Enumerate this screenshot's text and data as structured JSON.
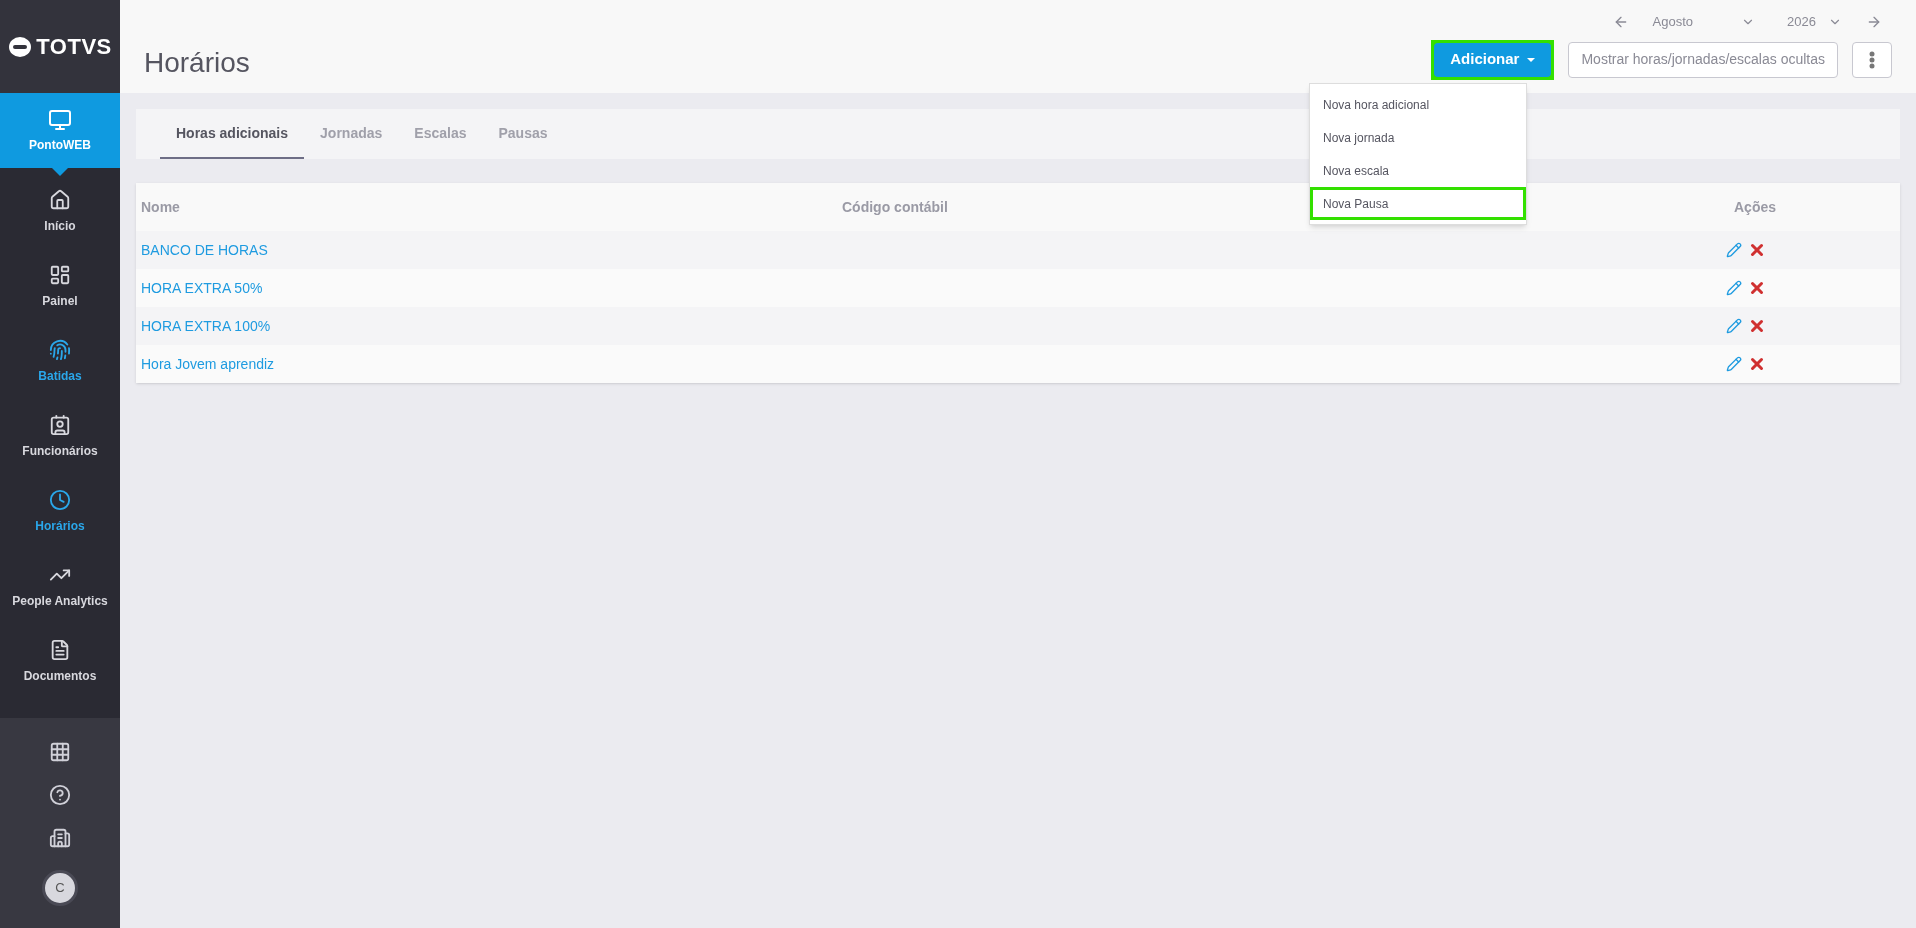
{
  "sidebar": {
    "logo": "TOTVS",
    "module": {
      "label": "PontoWEB",
      "selected": true
    },
    "items": [
      {
        "label": "Início",
        "highlighted": false
      },
      {
        "label": "Painel",
        "highlighted": false
      },
      {
        "label": "Batidas",
        "highlighted": true
      },
      {
        "label": "Funcionários",
        "highlighted": false
      },
      {
        "label": "Horários",
        "highlighted": true
      },
      {
        "label": "People Analytics",
        "highlighted": false
      },
      {
        "label": "Documentos",
        "highlighted": false
      }
    ],
    "avatar": "C"
  },
  "header": {
    "title": "Horários",
    "period": {
      "month": "Agosto",
      "year": "2026"
    },
    "add_button": {
      "label": "Adicionar",
      "highlighted": true,
      "expanded": true
    },
    "hidden_button": "Mostrar horas/jornadas/escalas ocultas"
  },
  "dropdown": [
    {
      "label": "Nova hora adicional",
      "highlighted": false
    },
    {
      "label": "Nova jornada",
      "highlighted": false
    },
    {
      "label": "Nova escala",
      "highlighted": false
    },
    {
      "label": "Nova Pausa",
      "highlighted": true
    }
  ],
  "tabs": [
    {
      "label": "Horas adicionais",
      "selected": true
    },
    {
      "label": "Jornadas",
      "selected": false
    },
    {
      "label": "Escalas",
      "selected": false
    },
    {
      "label": "Pausas",
      "selected": false
    }
  ],
  "table": {
    "columns": [
      "Nome",
      "Código contábil",
      "Ações"
    ],
    "rows": [
      {
        "name": "BANCO DE HORAS"
      },
      {
        "name": "HORA EXTRA 50%"
      },
      {
        "name": "HORA EXTRA 100%"
      },
      {
        "name": "Hora Jovem aprendiz"
      }
    ]
  }
}
